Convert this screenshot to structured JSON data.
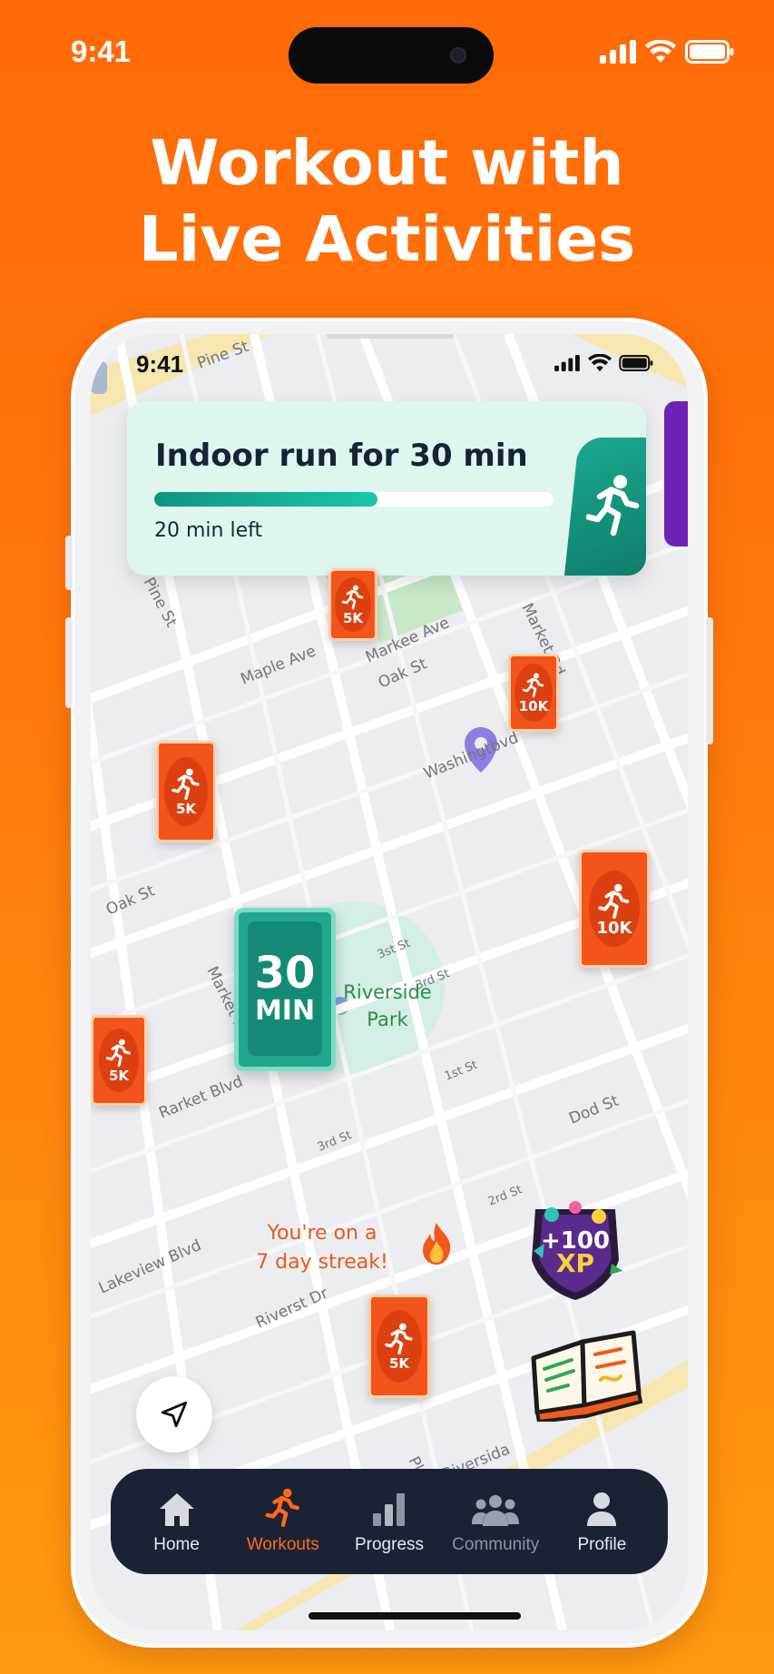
{
  "outer_status": {
    "time": "9:41"
  },
  "headline": {
    "line1": "Workout with",
    "line2": "Live Activities"
  },
  "inner_status": {
    "time": "9:41"
  },
  "live_activity": {
    "title": "Indoor run for 30 min",
    "progress_fraction": 0.56,
    "subtitle": "20 min left",
    "accent": "#19c7a7"
  },
  "map": {
    "featured_pin": {
      "value": "30",
      "unit": "MIN"
    },
    "park_label_line1": "Riverside",
    "park_label_line2": "Park",
    "streak_line1": "You're on a",
    "streak_line2": "7 day streak!",
    "streak_icon": "fire-icon",
    "xp_badge": {
      "line1": "+100",
      "line2": "XP"
    },
    "pins": [
      {
        "label": "5K"
      },
      {
        "label": "10K"
      },
      {
        "label": "5K"
      },
      {
        "label": "10K"
      },
      {
        "label": "5K"
      },
      {
        "label": "5K"
      }
    ],
    "streets": [
      "Pine St",
      "Pine St",
      "Maple Ave",
      "Markee Ave",
      "Oak St",
      "Market Rd",
      "Washingtbvd",
      "Oak St",
      "Market Rd",
      "Rarket Blvd",
      "Lakeview Blvd",
      "Riverst Dr",
      "Riversida",
      "Plont St",
      "3st St",
      "3rd St",
      "1st St",
      "2rd St",
      "3rd St",
      "Dod St"
    ]
  },
  "tabbar": {
    "items": [
      {
        "label": "Home",
        "icon": "home-icon"
      },
      {
        "label": "Workouts",
        "icon": "runner-icon",
        "active": true
      },
      {
        "label": "Progress",
        "icon": "bar-chart-icon"
      },
      {
        "label": "Community",
        "icon": "people-icon"
      },
      {
        "label": "Profile",
        "icon": "person-icon"
      }
    ],
    "active_color": "#ff6a1a"
  },
  "colors": {
    "background": "#ff7a0c",
    "brand_orange": "#f2541b",
    "teal": "#20a88f"
  }
}
